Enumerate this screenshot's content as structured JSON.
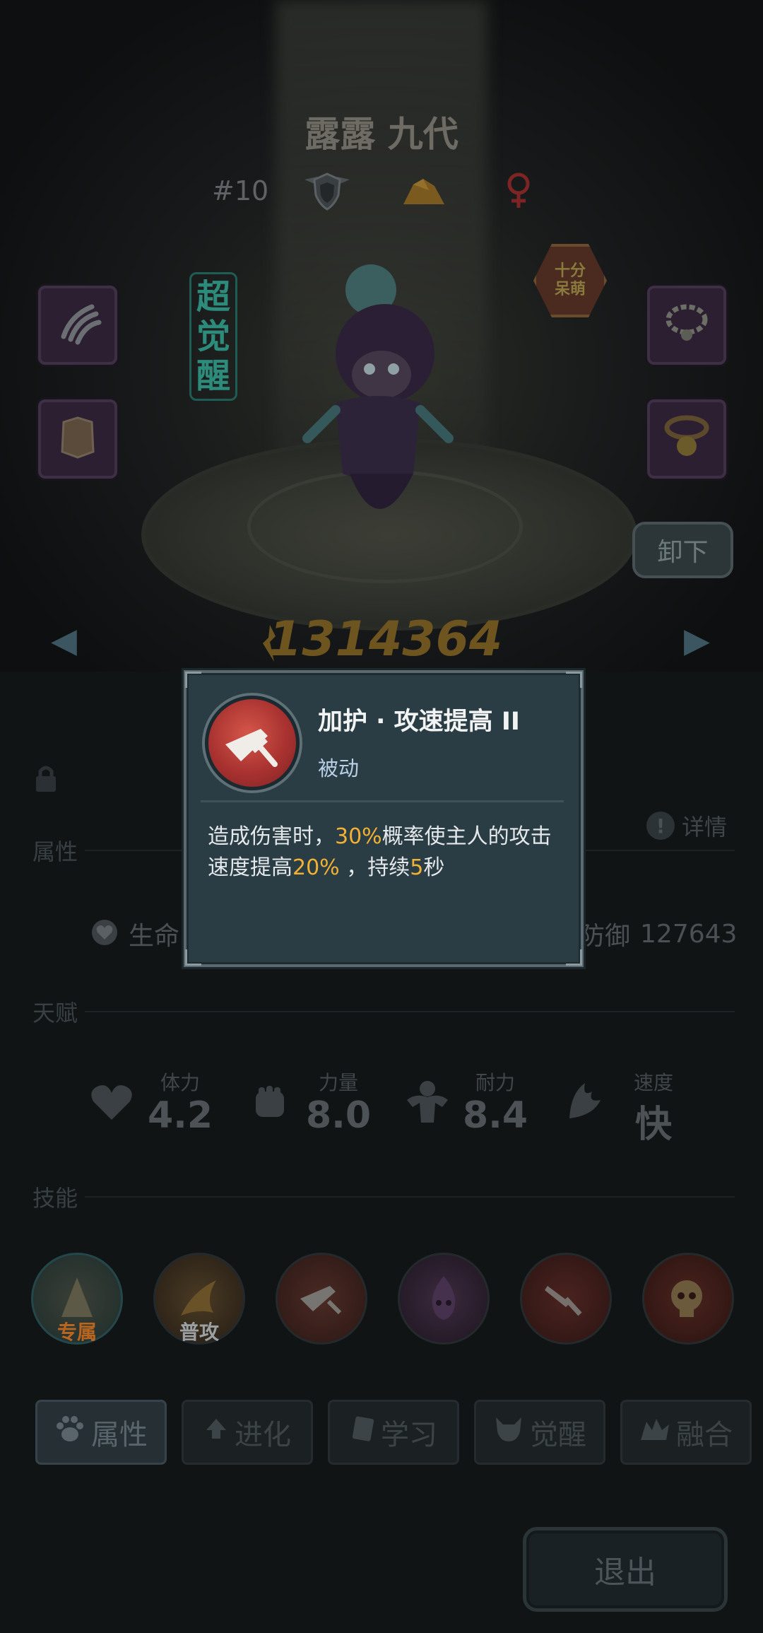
{
  "hero": {
    "name": "露露 九代",
    "rank": "#10",
    "awakening_label": "超觉醒",
    "personality_badge": "十分呆萌",
    "power_value": "1314364",
    "unequip_label": "卸下"
  },
  "stats": {
    "section_attributes": "属性",
    "section_talent": "天赋",
    "section_skills": "技能",
    "details_label": "详情",
    "hp_label": "生命",
    "defense_label": "防御",
    "defense_value": "127643"
  },
  "talents": [
    {
      "name": "体力",
      "value": "4.2",
      "icon": "heart-icon"
    },
    {
      "name": "力量",
      "value": "8.0",
      "icon": "fist-icon"
    },
    {
      "name": "耐力",
      "value": "8.4",
      "icon": "muscle-icon"
    },
    {
      "name": "速度",
      "value": "快",
      "icon": "wing-icon"
    }
  ],
  "skills": [
    {
      "tag": "专属",
      "tag_color": "#b8651f",
      "icon": "exclusive-skill-icon"
    },
    {
      "tag": "普攻",
      "tag_color": "#9aa0a3",
      "icon": "basic-attack-icon"
    },
    {
      "tag": "",
      "icon": "sword-skill-icon"
    },
    {
      "tag": "",
      "icon": "purple-flame-skill-icon"
    },
    {
      "tag": "",
      "icon": "sword-strike-skill-icon"
    },
    {
      "tag": "",
      "icon": "skull-skill-icon"
    }
  ],
  "tabs": [
    {
      "label": "属性",
      "active": true
    },
    {
      "label": "进化",
      "active": false
    },
    {
      "label": "学习",
      "active": false
    },
    {
      "label": "觉醒",
      "active": false
    },
    {
      "label": "融合",
      "active": false
    }
  ],
  "exit_label": "退出",
  "popup": {
    "skill_name": "加护 · 攻速提高 II",
    "skill_type": "被动",
    "desc_part1": "造成伤害时，",
    "desc_hl1": "30%",
    "desc_part2": "概率使主人的攻击速度提高",
    "desc_hl2": "20%",
    "desc_part3": " ，持续",
    "desc_hl3": "5",
    "desc_part4": "秒",
    "highlight_color": "#f2b134"
  },
  "colors": {
    "power": "#6e5520",
    "awakening": "#2c8b7b"
  }
}
